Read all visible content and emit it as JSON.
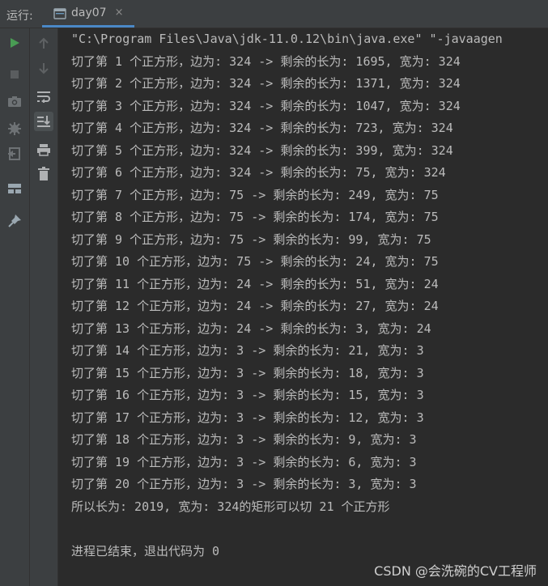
{
  "run_label": "运行:",
  "tab": {
    "label": "day07",
    "close": "×"
  },
  "console": {
    "command": "\"C:\\Program Files\\Java\\jdk-11.0.12\\bin\\java.exe\" \"-javaagen",
    "lines": [
      "切了第 1 个正方形，边为: 324 -> 剩余的长为: 1695, 宽为: 324",
      "切了第 2 个正方形，边为: 324 -> 剩余的长为: 1371, 宽为: 324",
      "切了第 3 个正方形，边为: 324 -> 剩余的长为: 1047, 宽为: 324",
      "切了第 4 个正方形，边为: 324 -> 剩余的长为: 723, 宽为: 324",
      "切了第 5 个正方形，边为: 324 -> 剩余的长为: 399, 宽为: 324",
      "切了第 6 个正方形，边为: 324 -> 剩余的长为: 75, 宽为: 324",
      "切了第 7 个正方形，边为: 75 -> 剩余的长为: 249, 宽为: 75",
      "切了第 8 个正方形，边为: 75 -> 剩余的长为: 174, 宽为: 75",
      "切了第 9 个正方形，边为: 75 -> 剩余的长为: 99, 宽为: 75",
      "切了第 10 个正方形，边为: 75 -> 剩余的长为: 24, 宽为: 75",
      "切了第 11 个正方形，边为: 24 -> 剩余的长为: 51, 宽为: 24",
      "切了第 12 个正方形，边为: 24 -> 剩余的长为: 27, 宽为: 24",
      "切了第 13 个正方形，边为: 24 -> 剩余的长为: 3, 宽为: 24",
      "切了第 14 个正方形，边为: 3 -> 剩余的长为: 21, 宽为: 3",
      "切了第 15 个正方形，边为: 3 -> 剩余的长为: 18, 宽为: 3",
      "切了第 16 个正方形，边为: 3 -> 剩余的长为: 15, 宽为: 3",
      "切了第 17 个正方形，边为: 3 -> 剩余的长为: 12, 宽为: 3",
      "切了第 18 个正方形，边为: 3 -> 剩余的长为: 9, 宽为: 3",
      "切了第 19 个正方形，边为: 3 -> 剩余的长为: 6, 宽为: 3",
      "切了第 20 个正方形，边为: 3 -> 剩余的长为: 3, 宽为: 3",
      "所以长为: 2019, 宽为: 324的矩形可以切 21 个正方形"
    ],
    "exit_message": "进程已结束，退出代码为 0"
  },
  "watermark": "CSDN @会洗碗的CV工程师",
  "colors": {
    "background": "#2b2b2b",
    "panel": "#3c3f41",
    "text": "#bbbbbb",
    "run_green": "#499c54",
    "tab_accent": "#4a88c7"
  },
  "icons": {
    "gutter_left": [
      "run-icon",
      "stop-icon",
      "camera-icon",
      "debug-icon",
      "exit-icon",
      "layout-icon",
      "pin-icon"
    ],
    "gutter_right": [
      "up-arrow-icon",
      "down-arrow-icon",
      "soft-wrap-icon",
      "scroll-to-end-icon",
      "print-icon",
      "trash-icon"
    ]
  }
}
